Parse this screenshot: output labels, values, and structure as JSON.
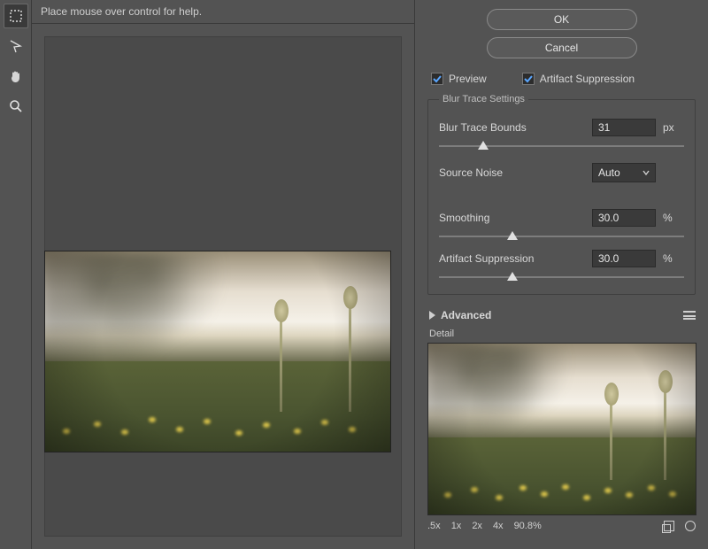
{
  "hint": "Place mouse over control for help.",
  "buttons": {
    "ok": "OK",
    "cancel": "Cancel"
  },
  "checks": {
    "preview": "Preview",
    "artifact": "Artifact Suppression"
  },
  "group": {
    "title": "Blur Trace Settings",
    "bounds": {
      "label": "Blur Trace Bounds",
      "value": "31",
      "unit": "px",
      "pct": 18
    },
    "noise": {
      "label": "Source Noise",
      "value": "Auto"
    },
    "smooth": {
      "label": "Smoothing",
      "value": "30.0",
      "unit": "%",
      "pct": 30
    },
    "artsup": {
      "label": "Artifact Suppression",
      "value": "30.0",
      "unit": "%",
      "pct": 30
    }
  },
  "advanced": "Advanced",
  "detail": "Detail",
  "zoom": {
    "levels": [
      ".5x",
      "1x",
      "2x",
      "4x"
    ],
    "current": "90.8%"
  }
}
